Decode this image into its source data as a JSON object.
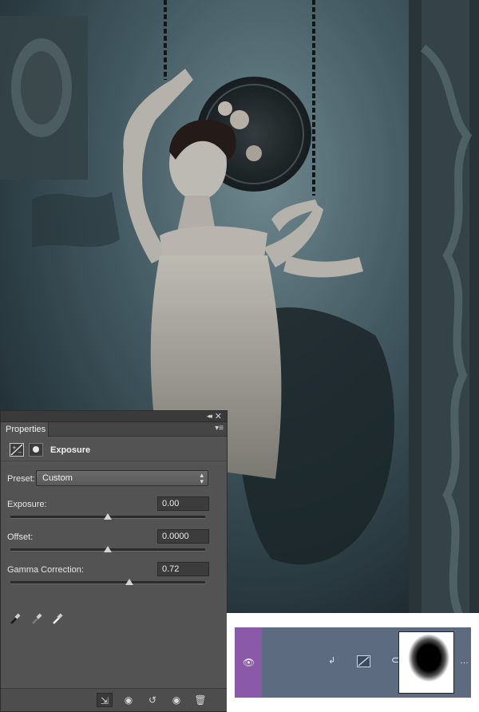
{
  "panel": {
    "tab_label": "Properties",
    "collapse_glyph": "◂◂",
    "close_glyph": "✕",
    "menu_glyph": "▾≡",
    "adjustment_name": "Exposure",
    "preset_label": "Preset:",
    "preset_value": "Custom",
    "exposure_label": "Exposure:",
    "exposure_value": "0.00",
    "exposure_slider_position": 0.5,
    "offset_label": "Offset:",
    "offset_value": "0.0000",
    "offset_slider_position": 0.5,
    "gamma_label": "Gamma Correction:",
    "gamma_value": "0.72",
    "gamma_slider_position": 0.61,
    "footer_buttons": [
      "clip-to-layer",
      "view-previous-state",
      "reset",
      "toggle-visibility",
      "delete"
    ]
  },
  "layer": {
    "selected_color": "#8a5aa9",
    "row_color": "#5c6b80",
    "icons": [
      "eye-icon",
      "clip-arrow-icon",
      "exposure-adjustment-icon",
      "link-icon",
      "layer-mask-thumbnail"
    ]
  },
  "colors": {
    "panel_bg": "#535353",
    "field_bg": "#3c3c3c",
    "text": "#e6e6e6"
  }
}
